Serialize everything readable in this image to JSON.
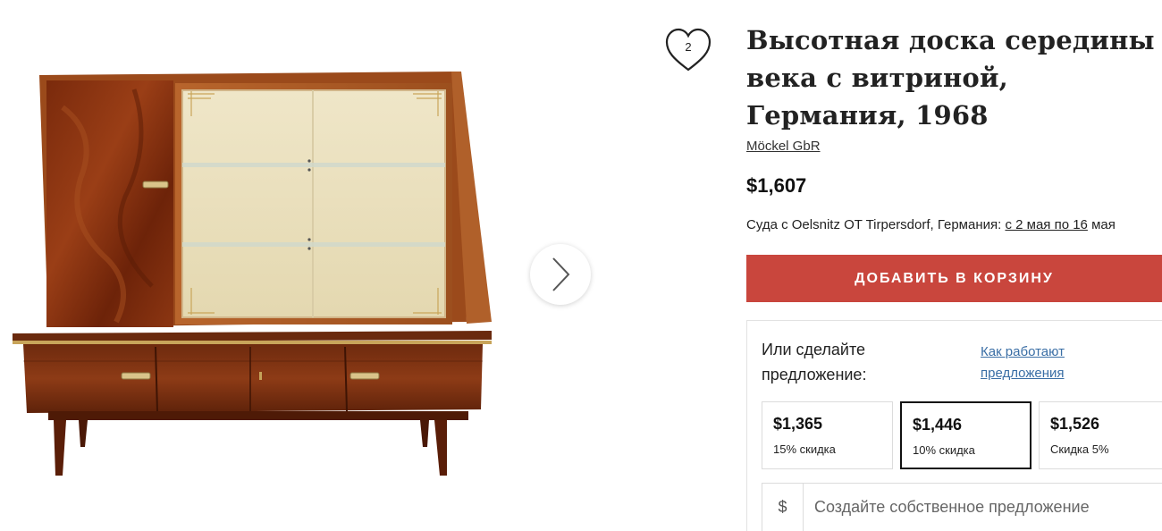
{
  "product": {
    "title": "Высотная доска середины века с витриной, Германия, 1968",
    "seller": "Möckel GbR",
    "price": "$1,607",
    "favorites_count": "2",
    "image_icon": "furniture-photo"
  },
  "shipping": {
    "prefix": "Суда с Oelsnitz OT Tirpersdorf, Германия:",
    "dates": " с 2 мая по 16",
    "suffix": "мая"
  },
  "cart": {
    "add_label": "ДОБАВИТЬ В КОРЗИНУ"
  },
  "offer": {
    "heading": "Или сделайте предложение:",
    "how_link": "Как работают предложения",
    "options": [
      {
        "amount": "$1,365",
        "discount": "15% скидка"
      },
      {
        "amount": "$1,446",
        "discount": "10% скидка"
      },
      {
        "amount": "$1,526",
        "discount": "Скидка 5%"
      }
    ],
    "selected_index": 1,
    "currency_symbol": "$",
    "custom_placeholder": "Создайте собственное предложение"
  },
  "colors": {
    "accent": "#c9463d",
    "link": "#3a6ea5",
    "wood_dark": "#6b2a10",
    "wood": "#8a3a17"
  }
}
